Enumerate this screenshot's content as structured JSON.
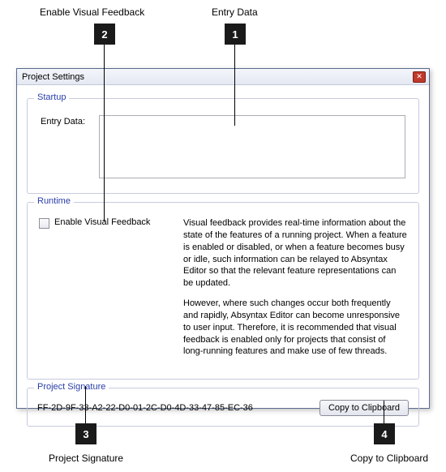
{
  "annotations": {
    "a1": {
      "num": "1",
      "label": "Entry Data"
    },
    "a2": {
      "num": "2",
      "label": "Enable Visual Feedback"
    },
    "a3": {
      "num": "3",
      "label": "Project Signature"
    },
    "a4": {
      "num": "4",
      "label": "Copy to Clipboard"
    }
  },
  "dialog": {
    "title": "Project Settings",
    "close": "✕",
    "groups": {
      "startup": {
        "legend": "Startup",
        "entry_label": "Entry Data:",
        "entry_value": ""
      },
      "runtime": {
        "legend": "Runtime",
        "checkbox_label": "Enable Visual Feedback",
        "desc_p1": "Visual feedback provides real-time information about the state of the features of a running project.  When a feature is enabled or disabled, or when a feature becomes busy or idle, such information can be relayed to Absyntax Editor so that the relevant feature representations can be updated.",
        "desc_p2": "However, where such changes occur both frequently and rapidly, Absyntax Editor can become unresponsive to user input.  Therefore, it is recommended that visual feedback is enabled only for projects that consist of long-running features and make use of few threads."
      },
      "signature": {
        "legend": "Project Signature",
        "value": "FF-2D-9F-33-A2-22-D0-01-2C-D0-4D-33-47-85-EC-36",
        "copy_label": "Copy to Clipboard"
      }
    }
  }
}
